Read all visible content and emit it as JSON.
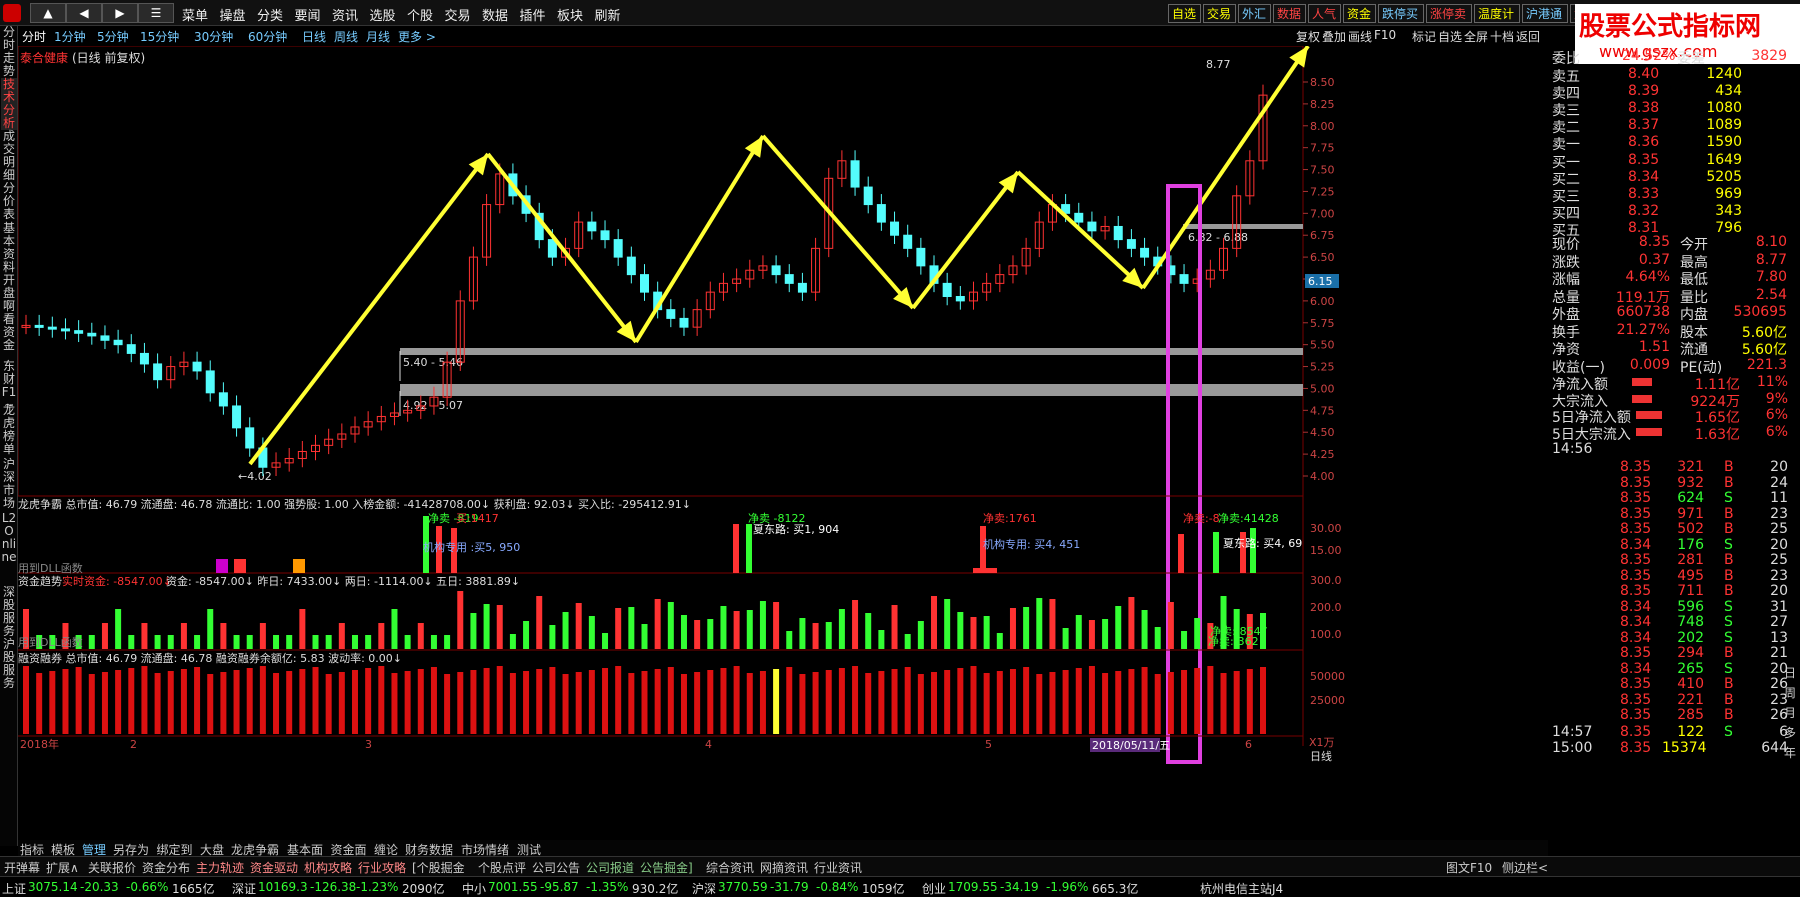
{
  "menubar": {
    "nav": [
      "▲",
      "◀",
      "▶",
      "☰"
    ],
    "items": [
      "菜单",
      "操盘",
      "分类",
      "要闻",
      "资讯",
      "选股",
      "个股",
      "交易",
      "数据",
      "插件",
      "板块",
      "刷新"
    ],
    "right_buttons": [
      {
        "label": "自选",
        "color": "#ff0"
      },
      {
        "label": "交易",
        "color": "#ff0"
      },
      {
        "label": "外汇",
        "color": "#7cf"
      },
      {
        "label": "数据",
        "color": "#f44"
      },
      {
        "label": "人气",
        "color": "#f44"
      },
      {
        "label": "资金",
        "color": "#ff0"
      },
      {
        "label": "跌停买",
        "color": "#7cf"
      },
      {
        "label": "涨停卖",
        "color": "#f44"
      },
      {
        "label": "温度计",
        "color": "#ff0"
      },
      {
        "label": "沪港通",
        "color": "#7cf"
      },
      {
        "label": "竞价",
        "color": "#f44"
      }
    ]
  },
  "watermark": {
    "title": "股票公式指标网",
    "url": "www.gszx.com"
  },
  "timeframes": [
    "分时",
    "1分钟",
    "5分钟",
    "15分钟",
    "30分钟",
    "60分钟",
    "日线",
    "周线",
    "月线",
    "更多 >"
  ],
  "right_tools": [
    "复权",
    "叠加",
    "画线",
    "F10",
    "标记",
    "自选",
    "全屏",
    "十档",
    "返回"
  ],
  "left_nav": [
    "分时走势",
    "技术分析",
    "成交明细",
    "分价表",
    "基本资料",
    "开盘啊看",
    "资金",
    "东财F1~",
    "龙虎榜单",
    "沪深市场",
    "L2 Online",
    "深股服务",
    "沪股服务"
  ],
  "stock": {
    "name": "泰合健康",
    "period_label": "(日线 前复权)"
  },
  "price_axis": {
    "labels": [
      "8.50",
      "8.25",
      "8.00",
      "7.75",
      "7.50",
      "7.25",
      "7.00",
      "6.75",
      "6.50",
      "6.25",
      "6.00",
      "5.75",
      "5.50",
      "5.25",
      "5.00",
      "4.75",
      "4.50",
      "4.25",
      "4.00"
    ],
    "current": "6.15"
  },
  "annotations": {
    "high": "8.77",
    "low": "4.02",
    "zone1": "5.40 - 5.46",
    "zone2": "4.92 - 5.07",
    "zone3": "6.82 - 6.88"
  },
  "colors": {
    "up": "#ff3232",
    "down": "#54fcfc",
    "arrow": "#ffff33",
    "box": "#e040e0",
    "green": "#33ff33"
  },
  "indicators": {
    "longhu": "龙虎争霸  总市值: 46.79  流通盘: 46.78  流通比: 1.00  强势股: 1.00  入榜金额: -41428708.00↓  获利盘: 92.03↓  买入比: -295412.91↓",
    "longhu_labels": [
      "净卖 -819",
      "买:1417",
      "机构专用 :买5, 950",
      "净卖 -8122",
      "夏东路: 买1, 904",
      "净卖:1761",
      "机构专用: 买4, 451",
      "净卖:-8",
      "净卖:41428",
      "夏东路: 买4, 69"
    ],
    "zijin": "资金趋势",
    "zijin_real": "实时资金: -8547.00↓",
    "zijin_rest": "资金: -8547.00↓  昨日: 7433.00↓  两日: -1114.00↓  五日: 3881.89↓",
    "zijin_labels": [
      "净卖:-8547",
      "净卖:-362"
    ],
    "dll": "用到DLL函数",
    "rongzi": "融资融券  总市值: 46.79  流通盘: 46.78  融资融券余额亿: 5.83  波动率: 0.00↓",
    "ind_axis1": [
      "30.00",
      "15.00"
    ],
    "ind_axis2": [
      "300.0",
      "200.0",
      "100.0"
    ],
    "ind_axis3": [
      "50000",
      "25000"
    ],
    "date_labels": [
      "2018年",
      "2",
      "3",
      "4",
      "5",
      "6"
    ],
    "cursor_date": "2018/05/11/五",
    "unit": "X1万",
    "period": "日线"
  },
  "quote": {
    "header": {
      "label1": "委比",
      "val1": "24.52%",
      "label2": "委差",
      "val2": "3829"
    },
    "sell": [
      {
        "l": "卖五",
        "p": "8.40",
        "v": "1240"
      },
      {
        "l": "卖四",
        "p": "8.39",
        "v": "434"
      },
      {
        "l": "卖三",
        "p": "8.38",
        "v": "1080"
      },
      {
        "l": "卖二",
        "p": "8.37",
        "v": "1089"
      },
      {
        "l": "卖一",
        "p": "8.36",
        "v": "1590"
      }
    ],
    "buy": [
      {
        "l": "买一",
        "p": "8.35",
        "v": "1649"
      },
      {
        "l": "买二",
        "p": "8.34",
        "v": "5205"
      },
      {
        "l": "买三",
        "p": "8.33",
        "v": "969"
      },
      {
        "l": "买四",
        "p": "8.32",
        "v": "343"
      },
      {
        "l": "买五",
        "p": "8.31",
        "v": "796"
      }
    ],
    "stats": [
      {
        "l1": "现价",
        "v1": "8.35",
        "l2": "今开",
        "v2": "8.10"
      },
      {
        "l1": "涨跌",
        "v1": "0.37",
        "l2": "最高",
        "v2": "8.77"
      },
      {
        "l1": "涨幅",
        "v1": "4.64%",
        "l2": "最低",
        "v2": "7.80"
      },
      {
        "l1": "总量",
        "v1": "119.1万",
        "l2": "量比",
        "v2": "2.54"
      },
      {
        "l1": "外盘",
        "v1": "660738",
        "l2": "内盘",
        "v2": "530695"
      },
      {
        "l1": "换手",
        "v1": "21.27%",
        "l2": "股本",
        "v2": "5.60亿"
      },
      {
        "l1": "净资",
        "v1": "1.51",
        "l2": "流通",
        "v2": "5.60亿"
      },
      {
        "l1": "收益(一)",
        "v1": "0.009",
        "l2": "PE(动)",
        "v2": "221.3"
      }
    ],
    "flows": [
      {
        "l": "净流入额",
        "v": "1.11亿",
        "p": "11%"
      },
      {
        "l": "大宗流入",
        "v": "9224万",
        "p": "9%"
      },
      {
        "l": "5日净流入额",
        "v": "1.65亿",
        "p": "6%"
      },
      {
        "l": "5日大宗流入",
        "v": "1.63亿",
        "p": "6%"
      }
    ],
    "first_time": "14:56",
    "ticks": [
      {
        "p": "8.35",
        "v": "321",
        "s": "B",
        "n": "20"
      },
      {
        "p": "8.35",
        "v": "932",
        "s": "B",
        "n": "24"
      },
      {
        "p": "8.35",
        "v": "624",
        "s": "S",
        "n": "11"
      },
      {
        "p": "8.35",
        "v": "971",
        "s": "B",
        "n": "23"
      },
      {
        "p": "8.35",
        "v": "502",
        "s": "B",
        "n": "25"
      },
      {
        "p": "8.34",
        "v": "176",
        "s": "S",
        "n": "20"
      },
      {
        "p": "8.35",
        "v": "281",
        "s": "B",
        "n": "25"
      },
      {
        "p": "8.35",
        "v": "495",
        "s": "B",
        "n": "23"
      },
      {
        "p": "8.35",
        "v": "711",
        "s": "B",
        "n": "20"
      },
      {
        "p": "8.34",
        "v": "596",
        "s": "S",
        "n": "31"
      },
      {
        "p": "8.34",
        "v": "748",
        "s": "S",
        "n": "27"
      },
      {
        "p": "8.34",
        "v": "202",
        "s": "S",
        "n": "13"
      },
      {
        "p": "8.35",
        "v": "294",
        "s": "B",
        "n": "21"
      },
      {
        "p": "8.34",
        "v": "265",
        "s": "S",
        "n": "20"
      },
      {
        "p": "8.35",
        "v": "410",
        "s": "B",
        "n": "26"
      },
      {
        "p": "8.35",
        "v": "221",
        "s": "B",
        "n": "23"
      },
      {
        "p": "8.35",
        "v": "285",
        "s": "B",
        "n": "26"
      }
    ],
    "tail": [
      {
        "t": "14:57",
        "p": "8.35",
        "v": "122",
        "s": "S",
        "n": "6"
      },
      {
        "t": "15:00",
        "p": "8.35",
        "v": "15374",
        "s": "",
        "n": "644"
      }
    ],
    "tabs": [
      "笔",
      "价",
      "细",
      "势",
      "联",
      "值",
      "主",
      "筹"
    ],
    "right_icons": [
      "日",
      "周",
      "月",
      "多",
      "年"
    ]
  },
  "bottom_tabs": [
    "开弹幕",
    "扩展∧",
    "关联报价",
    "资金分布",
    "主力轨迹",
    "资金驱动",
    "机构攻略",
    "行业攻略",
    "[个股掘金",
    "个股点评",
    "公司公告",
    "公司报道",
    "公告掘金]",
    "综合资讯",
    "网摘资讯",
    "行业资讯"
  ],
  "bottom_mid": [
    "指标",
    "模板",
    "管理",
    "另存为",
    "绑定到",
    "大盘",
    "龙虎争霸",
    "基本面",
    "资金面",
    "缠论",
    "财务数据",
    "市场情绪",
    "测试"
  ],
  "bottom_right": [
    "图文F10",
    "侧边栏<"
  ],
  "ticker": [
    {
      "name": "上证",
      "val": "3075.14",
      "chg": "-20.33",
      "pct": "-0.66%",
      "amt": "1665亿"
    },
    {
      "name": "深证",
      "val": "10169.3",
      "chg": "-126.38",
      "pct": "-1.23%",
      "amt": "2090亿"
    },
    {
      "name": "中小",
      "val": "7001.55",
      "chg": "-95.87",
      "pct": "-1.35%",
      "amt": "930.2亿"
    },
    {
      "name": "沪深",
      "val": "3770.59",
      "chg": "-31.79",
      "pct": "-0.84%",
      "amt": "1059亿"
    },
    {
      "name": "创业",
      "val": "1709.55",
      "chg": "-34.19",
      "pct": "-1.96%",
      "amt": "665.3亿"
    }
  ],
  "server": "杭州电信主站J4"
}
